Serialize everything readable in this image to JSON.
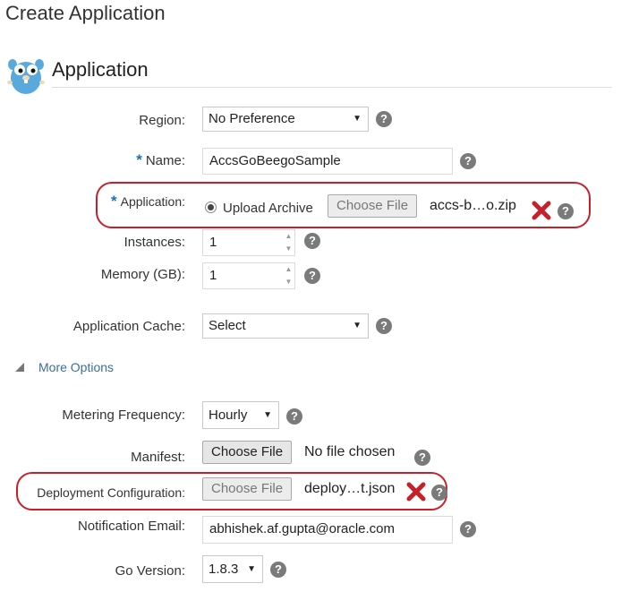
{
  "page": {
    "title": "Create Application"
  },
  "section": {
    "title": "Application"
  },
  "form": {
    "region": {
      "label": "Region:",
      "value": "No Preference"
    },
    "name": {
      "required": "*",
      "label": "Name:",
      "value": "AccsGoBeegoSample"
    },
    "application": {
      "required": "*",
      "label": "Application:",
      "option": "Upload Archive",
      "button": "Choose File",
      "file": "accs-b…o.zip"
    },
    "instances": {
      "label": "Instances:",
      "value": "1"
    },
    "memory": {
      "label": "Memory (GB):",
      "value": "1"
    },
    "cache": {
      "label": "Application Cache:",
      "value": "Select"
    },
    "more_options": {
      "label": "More Options"
    },
    "metering": {
      "label": "Metering Frequency:",
      "value": "Hourly"
    },
    "manifest": {
      "label": "Manifest:",
      "button": "Choose File",
      "file": "No file chosen"
    },
    "deployment": {
      "label": "Deployment Configuration:",
      "button": "Choose File",
      "file": "deploy…t.json"
    },
    "email": {
      "label": "Notification Email:",
      "value": "abhishek.af.gupta@oracle.com"
    },
    "go_version": {
      "label": "Go Version:",
      "value": "1.8.3"
    }
  },
  "icons": {
    "help": "help-icon",
    "remove": "remove-x-icon",
    "app": "gopher-icon"
  },
  "colors": {
    "highlight": "#c8202b",
    "required": "#1a73b5",
    "remove_x": "#c8202b"
  }
}
